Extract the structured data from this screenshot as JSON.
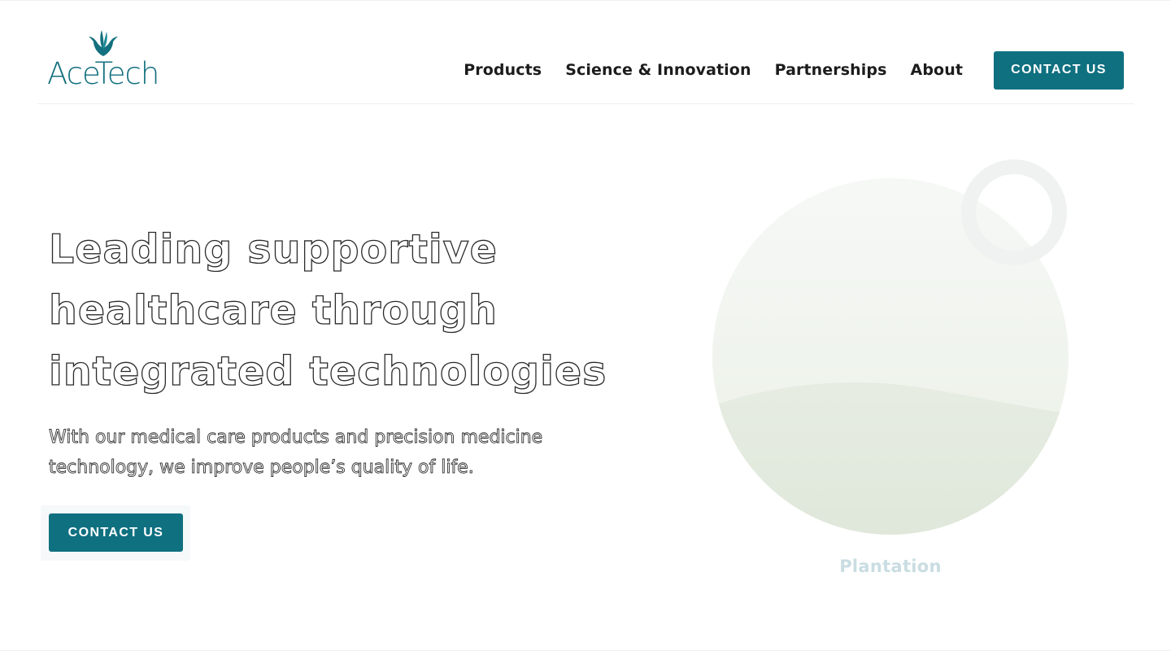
{
  "brand": {
    "name": "AceTech",
    "logo_icon": "agave-leaf-icon",
    "accent_color": "#0f7080"
  },
  "nav": {
    "items": [
      {
        "label": "Products"
      },
      {
        "label": "Science & Innovation"
      },
      {
        "label": "Partnerships"
      },
      {
        "label": "About"
      }
    ],
    "cta_label": "CONTACT US"
  },
  "hero": {
    "title_lines": [
      "Leading supportive",
      "healthcare through",
      "integrated technologies"
    ],
    "subtitle_lines": [
      "With our medical care products and precision medicine",
      "technology, we improve people’s quality of life."
    ],
    "cta_label": "CONTACT US"
  },
  "visual": {
    "caption": "Plantation"
  }
}
